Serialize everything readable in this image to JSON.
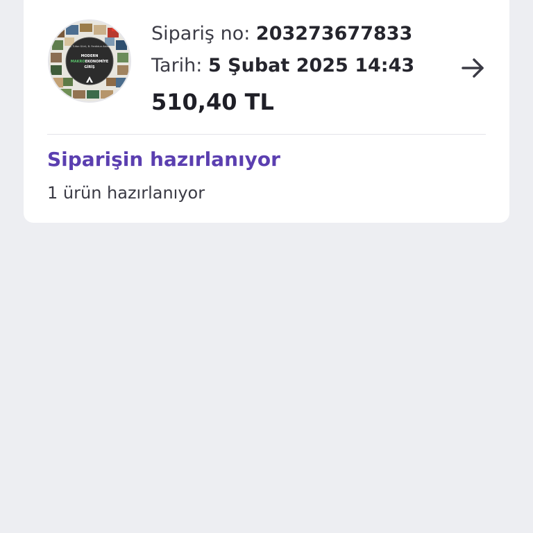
{
  "order": {
    "number_label": "Sipariş no:",
    "number_value": "203273677833",
    "date_label": "Tarih:",
    "date_value": "5 Şubat 2025 14:43",
    "price": "510,40 TL",
    "thumbnail": {
      "icon": "book-cover-thumbnail",
      "authors": "A. Tufan Gürü, B. Ferdidun Aslan",
      "title_line1": "MODERN",
      "title_accent": "MAKRO",
      "title_rest": "EKONOMİYE",
      "title_line2": "GİRİŞ"
    }
  },
  "status": {
    "title": "Siparişin hazırlanıyor",
    "subtitle": "1 ürün hazırlanıyor"
  },
  "icons": {
    "arrow": "arrow-right-icon"
  },
  "colors": {
    "background": "#edeef2",
    "card": "#ffffff",
    "status_accent": "#5b3fb0",
    "text_dark": "#25252d"
  }
}
